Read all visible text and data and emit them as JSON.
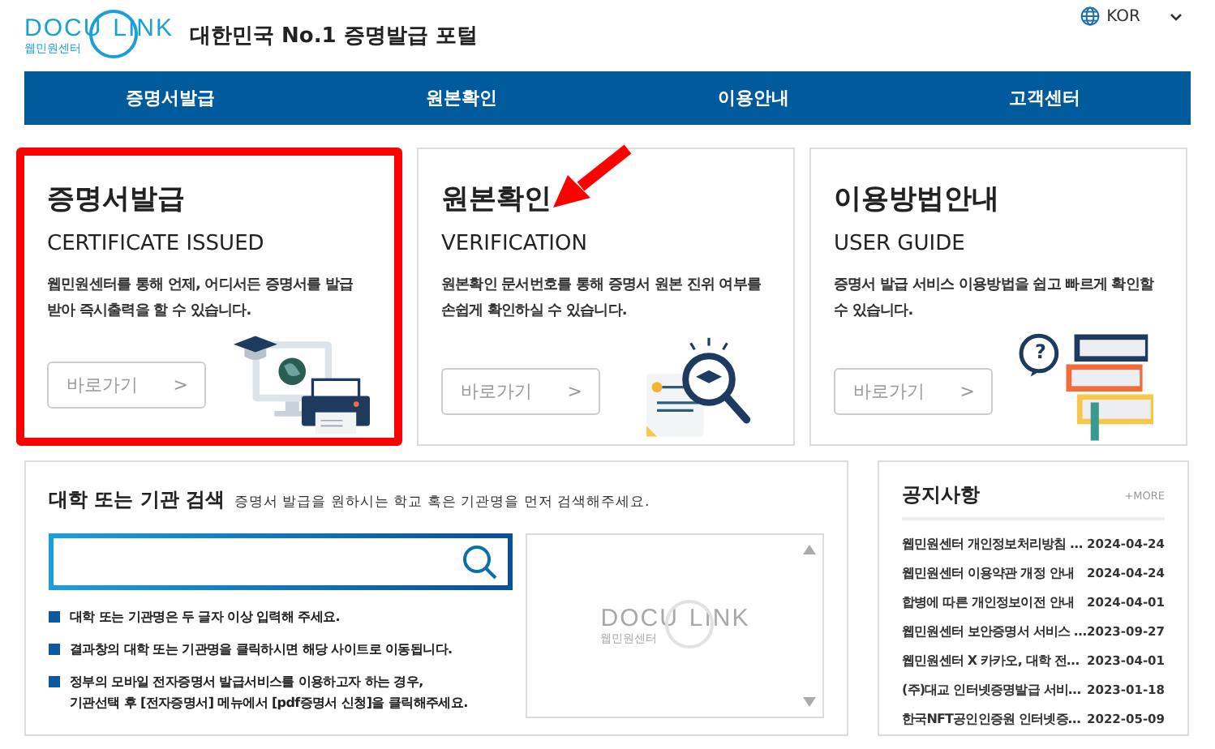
{
  "header": {
    "logo": {
      "left": "DOCU",
      "right": "LINK",
      "sub": "웹민원센터"
    },
    "tagline": "대한민국 No.1 증명발급 포털",
    "language": "KOR"
  },
  "nav": [
    {
      "label": "증명서발급"
    },
    {
      "label": "원본확인"
    },
    {
      "label": "이용안내"
    },
    {
      "label": "고객센터"
    }
  ],
  "cards": [
    {
      "kind": "issue",
      "title": "증명서발급",
      "subtitle": "CERTIFICATE ISSUED",
      "description": "웹민원센터를 통해 언제, 어디서든 증명서를 발급 받아 즉시출력을 할 수 있습니다.",
      "button": "바로가기",
      "button_arrow": ">",
      "highlighted": true
    },
    {
      "kind": "verify",
      "title": "원본확인",
      "subtitle": "VERIFICATION",
      "description": "원본확인 문서번호를 통해 증명서 원본 진위 여부를 손쉽게 확인하실 수 있습니다.",
      "button": "바로가기",
      "button_arrow": ">",
      "highlighted": false
    },
    {
      "kind": "guide",
      "title": "이용방법안내",
      "subtitle": "USER GUIDE",
      "description": "증명서 발급 서비스 이용방법을 쉽고 빠르게 확인할 수 있습니다.",
      "button": "바로가기",
      "button_arrow": ">",
      "highlighted": false,
      "bubble_mark": "?"
    }
  ],
  "search": {
    "title": "대학 또는 기관 검색",
    "hint": "증명서 발급을 원하시는 학교 혹은 기관명을 먼저 검색해주세요.",
    "notes": [
      "대학 또는 기관명은 두 글자 이상 입력해 주세요.",
      "결과창의 대학 또는 기관명을 클릭하시면 해당 사이트로 이동됩니다.",
      "정부의 모바일 전자증명서 발급서비스를 이용하고자 하는 경우,\n기관선택 후 [전자증명서] 메뉴에서 [pdf증명서 신청]을 클릭해주세요."
    ],
    "results_logo": {
      "left": "DOCU",
      "right": "LINK",
      "sub": "웹민원센터"
    }
  },
  "notices": {
    "title": "공지사항",
    "more": "+MORE",
    "items": [
      {
        "title": "웹민원센터 개인정보처리방침 …",
        "date": "2024-04-24"
      },
      {
        "title": "웹민원센터 이용약관 개정 안내",
        "date": "2024-04-24"
      },
      {
        "title": "합병에 따른 개인정보이전 안내",
        "date": "2024-04-01"
      },
      {
        "title": "웹민원센터 보안증명서 서비스 …",
        "date": "2023-09-27"
      },
      {
        "title": "웹민원센터 X 카카오, 대학 전…",
        "date": "2023-04-01"
      },
      {
        "title": "(주)대교 인터넷증명발급 서비…",
        "date": "2023-01-18"
      },
      {
        "title": "한국NFT공인인증원 인터넷증…",
        "date": "2022-05-09"
      }
    ]
  }
}
